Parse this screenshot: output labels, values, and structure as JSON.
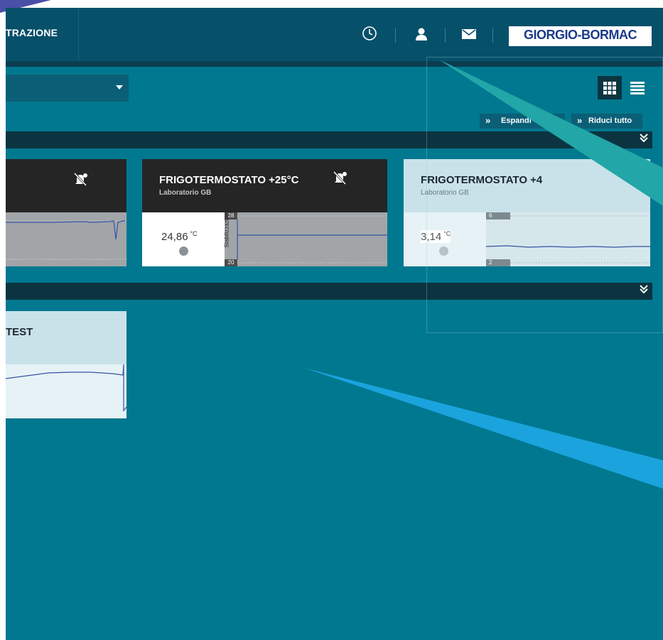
{
  "header": {
    "nav_title": "TRAZIONE",
    "icons": [
      "clock-icon",
      "user-icon",
      "mail-icon"
    ],
    "logo_text": "GIORGIO-BORMAC",
    "background": "#07506a"
  },
  "toolbar": {
    "expand_label": "Espandi",
    "collapse_label": "Riduci tutto",
    "grid_view_icon": "grid-icon",
    "list_view_icon": "list-icon"
  },
  "cards": [
    {
      "title": "",
      "subtitle": "",
      "value": "",
      "unit": "",
      "alarm_muted": true,
      "header_color": "#252525"
    },
    {
      "title": "FRIGOTERMOSTATO +25°C",
      "subtitle": "Laboratorio GB",
      "value": "24,86",
      "unit": "°C",
      "alarm_muted": true,
      "chart_max": "28",
      "chart_min": "20",
      "chart_label": "Stabilizzazione",
      "header_color": "#252525"
    },
    {
      "title": "FRIGOTERMOSTATO +4",
      "subtitle": "Laboratorio GB",
      "value": "3,14",
      "unit": "°C",
      "alarm_muted": false,
      "chart_max": "6",
      "chart_min": "2",
      "header_color": "#c9e2ea"
    },
    {
      "title": "TEST",
      "subtitle": "",
      "header_color": "#c9e2ea"
    }
  ],
  "colors": {
    "page_bg": "#00788f",
    "group_bar": "#0b3440",
    "accent_arrow": "#1aa3dd",
    "accent_arrow2": "#22a6a8"
  }
}
